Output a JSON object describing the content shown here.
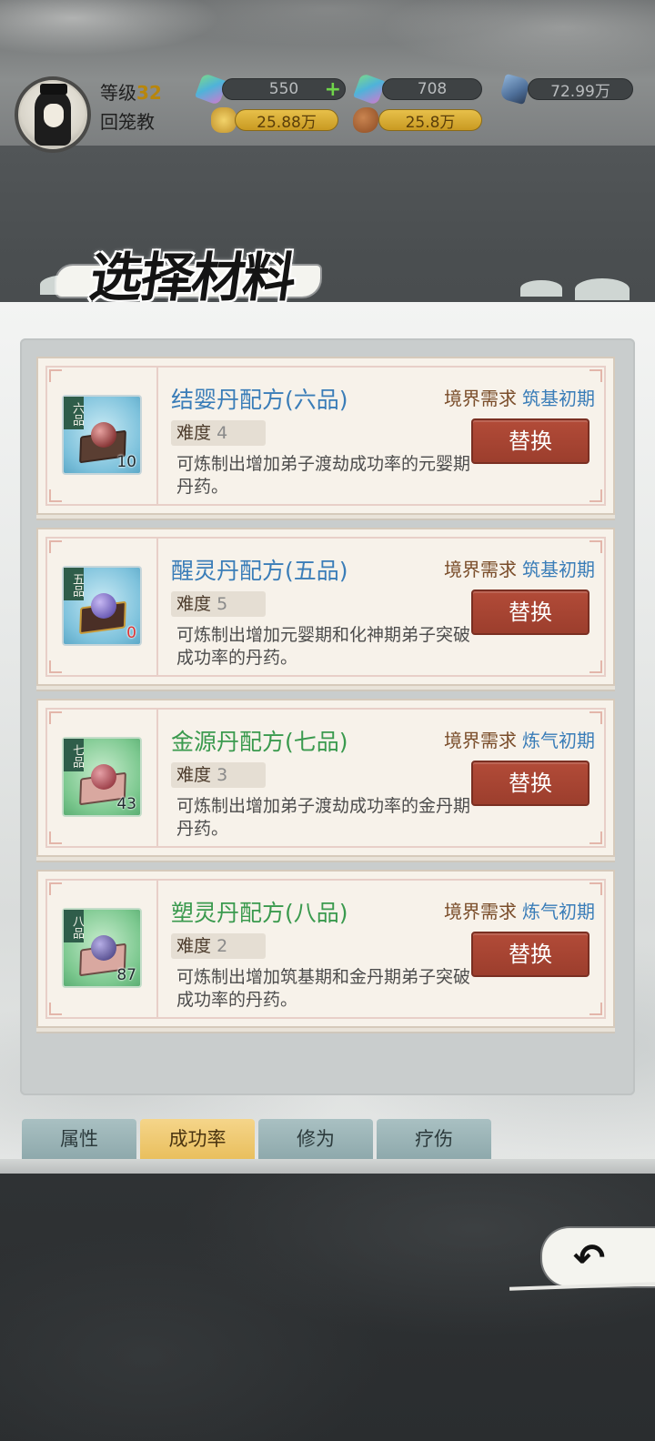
{
  "header": {
    "level_label": "等级",
    "level_value": "32",
    "sect_name": "回笼教",
    "resources": {
      "jade": "550",
      "spirit_gem": "708",
      "crystal": "72.99万",
      "gold": "25.88万",
      "food": "25.8万"
    }
  },
  "title": "选择材料",
  "requirement_label": "境界需求",
  "difficulty_label": "难度",
  "swap_label": "替换",
  "recipes": [
    {
      "grade_tag": "六品",
      "name": "结婴丹配方(六品)",
      "count": "10",
      "difficulty": "4",
      "requirement": "筑基初期",
      "desc": "可炼制出增加弟子渡劫成功率的元婴期丹药。"
    },
    {
      "grade_tag": "五品",
      "name": "醒灵丹配方(五品)",
      "count": "0",
      "difficulty": "5",
      "requirement": "筑基初期",
      "desc": "可炼制出增加元婴期和化神期弟子突破成功率的丹药。"
    },
    {
      "grade_tag": "七品",
      "name": "金源丹配方(七品)",
      "count": "43",
      "difficulty": "3",
      "requirement": "炼气初期",
      "desc": "可炼制出增加弟子渡劫成功率的金丹期丹药。"
    },
    {
      "grade_tag": "八品",
      "name": "塑灵丹配方(八品)",
      "count": "87",
      "difficulty": "2",
      "requirement": "炼气初期",
      "desc": "可炼制出增加筑基期和金丹期弟子突破成功率的丹药。"
    }
  ],
  "tabs": [
    {
      "label": "属性"
    },
    {
      "label": "成功率"
    },
    {
      "label": "修为"
    },
    {
      "label": "疗伤"
    }
  ],
  "active_tab": "成功率",
  "icons": {
    "back": "back-arrow-icon",
    "add": "plus-icon"
  },
  "colors": {
    "swap_button": "#a8432f",
    "active_tab": "#f0c96a",
    "recipe_blue": "#3a7db8",
    "recipe_green": "#3a9a4e"
  }
}
